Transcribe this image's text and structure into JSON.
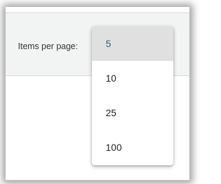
{
  "toolbar": {
    "items_per_page_label": "Items per page:"
  },
  "page_size_menu": {
    "selected": "5",
    "options": [
      {
        "label": "5"
      },
      {
        "label": "10"
      },
      {
        "label": "25"
      },
      {
        "label": "100"
      }
    ]
  },
  "colors": {
    "selected_option_background": "#e0e0e0",
    "selected_option_text": "#2f6077",
    "toolbar_background": "#f2f4f3"
  }
}
